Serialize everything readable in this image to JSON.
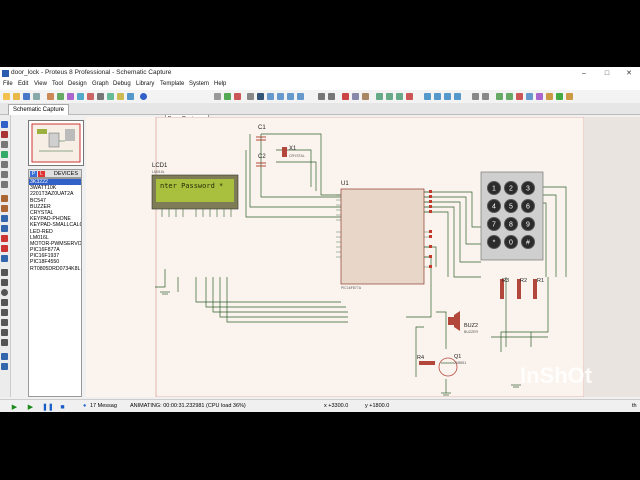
{
  "window": {
    "title": "door_lock - Proteus 8 Professional - Schematic Capture",
    "minimize": "–",
    "maximize": "□",
    "close": "✕"
  },
  "menu": [
    "File",
    "Edit",
    "View",
    "Tool",
    "Design",
    "Graph",
    "Debug",
    "Library",
    "Template",
    "System",
    "Help"
  ],
  "toolbar": {
    "design_combo": "Base Design"
  },
  "tab": {
    "label": "Schematic Capture"
  },
  "sidebar": {
    "header": "DEVICES",
    "pick_button": "P",
    "lib_button": "L",
    "devices": [
      "3WATT10K",
      "2201T3AZ0UAT2A",
      "BC547",
      "BUZZER",
      "CRYSTAL",
      "KEYPAD-PHONE",
      "KEYPAD-SMALLCALC",
      "LED-RED",
      "LM016L",
      "MOTOR-PWMSERVO",
      "PIC16F877A",
      "PIC16F1937",
      "PIC18F4550",
      "RT0805DRD0734K8L"
    ],
    "selected": "BUZZER",
    "extra_selected": "3K3222"
  },
  "schematic": {
    "lcd_label": "LCD1",
    "lcd_sub": "LM016L",
    "lcd_text": "nter Password",
    "lcd_cursor": "*",
    "c1": "C1",
    "c2": "C2",
    "x1": "X1",
    "x1_sub": "CRYSTAL",
    "u1": "U1",
    "u1_sub": "PIC16F877A",
    "keys": [
      "1",
      "2",
      "3",
      "4",
      "5",
      "6",
      "7",
      "8",
      "9",
      "*",
      "0",
      "#"
    ],
    "r1": "R1",
    "r2": "R2",
    "r3": "R3",
    "r4": "R4",
    "buz": "BUZ2",
    "buz_sub": "BUZZER",
    "q1": "Q1",
    "q1_sub": "2N5551"
  },
  "status": {
    "messages": "17 Messag",
    "animating": "ANIMATING: 00:00:31.232981 (CPU load 36%)",
    "x": "x  +3300.0",
    "y": "y  +1800.0",
    "units": "th"
  },
  "colors": {
    "canvas": "#fbf4ee",
    "wire": "#2e5f2e",
    "component": "#b3473b",
    "lcd_screen": "#a9c03e",
    "keypad": "#cfcfcf",
    "selection": "#3060c8"
  },
  "watermark": "InShOt"
}
